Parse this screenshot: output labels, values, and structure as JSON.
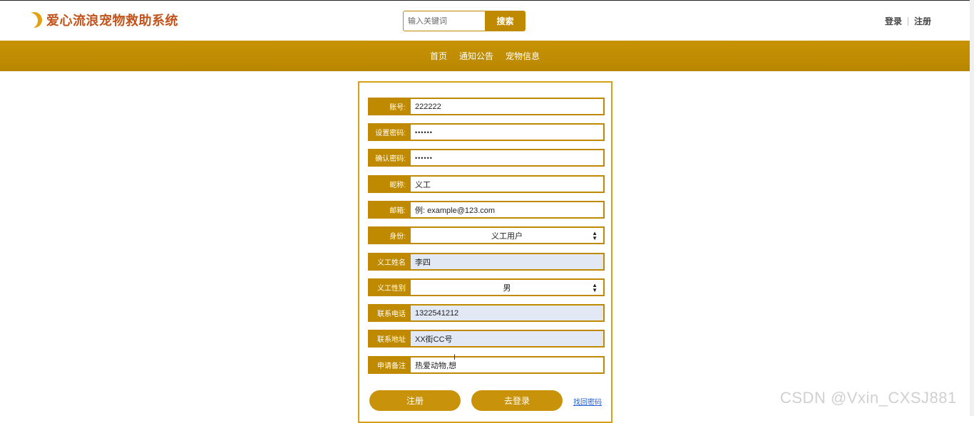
{
  "header": {
    "site_title": "爱心流浪宠物救助系统",
    "search_placeholder": "输入关键词",
    "search_button": "搜索",
    "login": "登录",
    "register": "注册"
  },
  "nav": {
    "items": [
      "首页",
      "通知公告",
      "宠物信息"
    ]
  },
  "form": {
    "fields": [
      {
        "label": "账号:",
        "value": "222222"
      },
      {
        "label": "设置密码:",
        "value": "••••••"
      },
      {
        "label": "确认密码:",
        "value": "••••••"
      },
      {
        "label": "昵称:",
        "value": "义工"
      },
      {
        "label": "邮箱:",
        "value": "例: example@123.com"
      },
      {
        "label": "身份:",
        "value": "义工用户"
      },
      {
        "label": "义工姓名",
        "value": "李四"
      },
      {
        "label": "义工性别",
        "value": "男"
      },
      {
        "label": "联系电话",
        "value": "1322541212"
      },
      {
        "label": "联系地址",
        "value": "XX街CC号"
      },
      {
        "label": "申请备注",
        "value": "热爱动物,想"
      }
    ],
    "register_button": "注册",
    "login_button": "去登录",
    "forgot_link": "找回密码"
  },
  "watermark": "CSDN @Vxin_CXSJ881",
  "colors": {
    "accent": "#c08a00",
    "title": "#c1531b",
    "filled_bg": "#e2e9f4",
    "link": "#1f5cd6"
  }
}
